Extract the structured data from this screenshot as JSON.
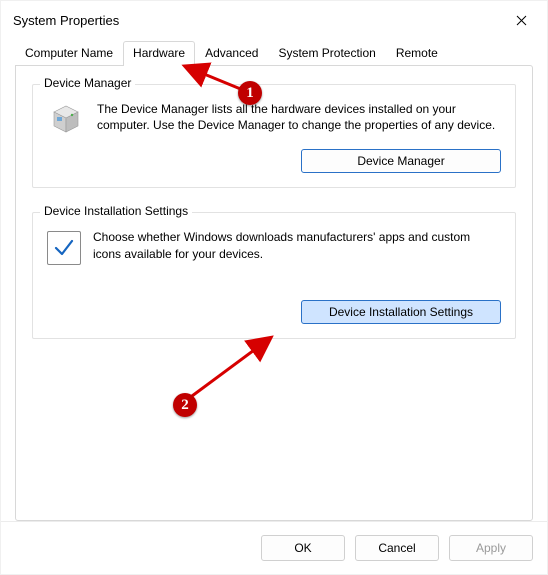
{
  "window": {
    "title": "System Properties"
  },
  "tabs": {
    "computer_name": "Computer Name",
    "hardware": "Hardware",
    "advanced": "Advanced",
    "system_protection": "System Protection",
    "remote": "Remote",
    "active": "hardware"
  },
  "device_manager": {
    "group_label": "Device Manager",
    "description": "The Device Manager lists all the hardware devices installed on your computer. Use the Device Manager to change the properties of any device.",
    "button_label": "Device Manager"
  },
  "installation_settings": {
    "group_label": "Device Installation Settings",
    "description": "Choose whether Windows downloads manufacturers' apps and custom icons available for your devices.",
    "button_label": "Device Installation Settings"
  },
  "footer": {
    "ok": "OK",
    "cancel": "Cancel",
    "apply": "Apply"
  },
  "annotations": {
    "badge1": "1",
    "badge2": "2"
  },
  "colors": {
    "accent": "#2a71c7",
    "badge": "#c00000",
    "arrow": "#d60000"
  }
}
